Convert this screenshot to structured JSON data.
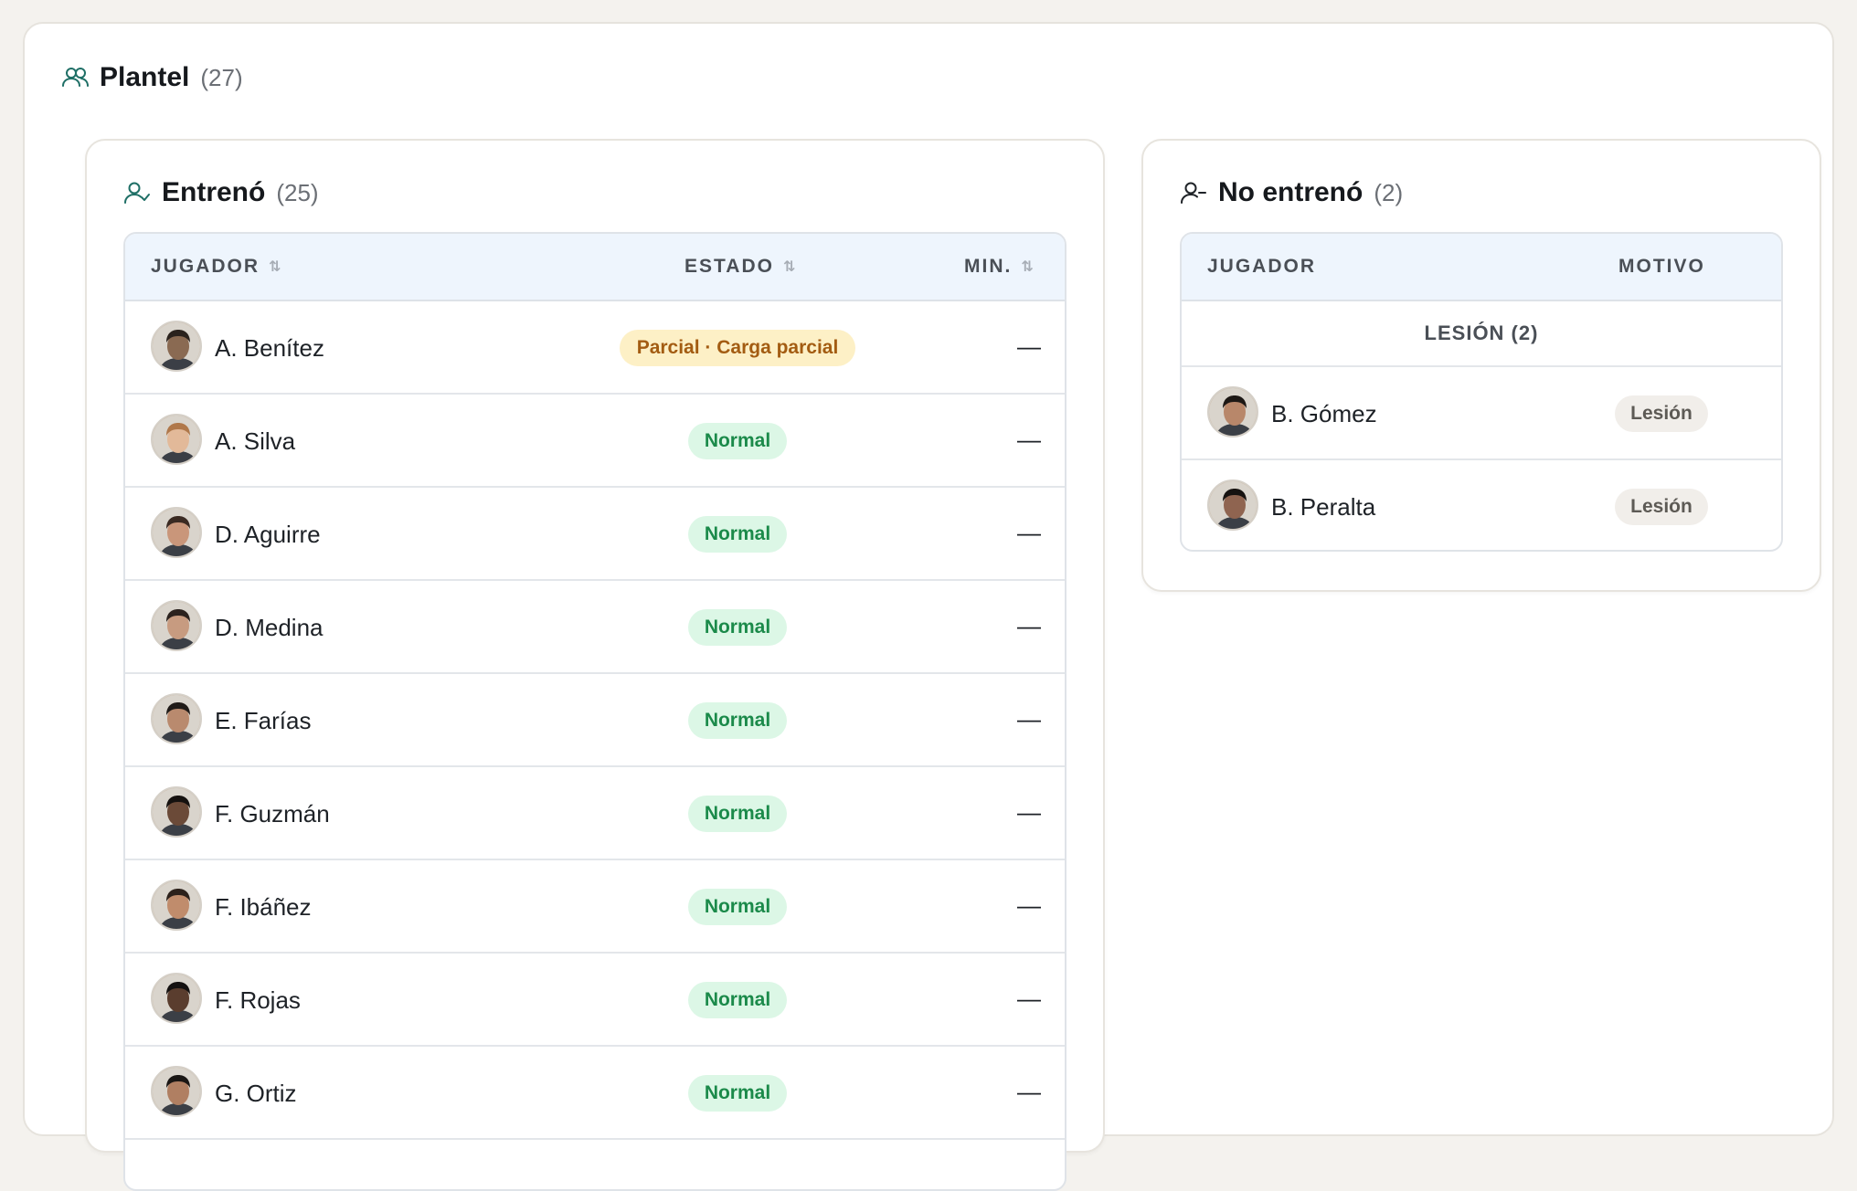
{
  "plantel": {
    "title": "Plantel",
    "count": "(27)"
  },
  "entreno": {
    "title": "Entrenó",
    "count": "(25)",
    "headers": {
      "player": "JUGADOR",
      "status": "ESTADO",
      "minutes": "MIN."
    },
    "sort_glyph": "⇅",
    "rows": [
      {
        "name": "A. Benítez",
        "status": "Parcial · Carga parcial",
        "status_kind": "partial",
        "minutes": "—",
        "skin": "#8a6a52",
        "hair": "#2a221d"
      },
      {
        "name": "A. Silva",
        "status": "Normal",
        "status_kind": "normal",
        "minutes": "—",
        "skin": "#e2b999",
        "hair": "#b0784a"
      },
      {
        "name": "D. Aguirre",
        "status": "Normal",
        "status_kind": "normal",
        "minutes": "—",
        "skin": "#c9967a",
        "hair": "#3a2a22"
      },
      {
        "name": "D. Medina",
        "status": "Normal",
        "status_kind": "normal",
        "minutes": "—",
        "skin": "#c79b80",
        "hair": "#2b221e"
      },
      {
        "name": "E. Farías",
        "status": "Normal",
        "status_kind": "normal",
        "minutes": "—",
        "skin": "#b98a6e",
        "hair": "#1f1a17"
      },
      {
        "name": "F. Guzmán",
        "status": "Normal",
        "status_kind": "normal",
        "minutes": "—",
        "skin": "#6b4a38",
        "hair": "#15110f"
      },
      {
        "name": "F. Ibáñez",
        "status": "Normal",
        "status_kind": "normal",
        "minutes": "—",
        "skin": "#c08c6c",
        "hair": "#2c211b"
      },
      {
        "name": "F. Rojas",
        "status": "Normal",
        "status_kind": "normal",
        "minutes": "—",
        "skin": "#5a3d2e",
        "hair": "#141110"
      },
      {
        "name": "G. Ortiz",
        "status": "Normal",
        "status_kind": "normal",
        "minutes": "—",
        "skin": "#b07f62",
        "hair": "#1a1614"
      }
    ]
  },
  "no_entreno": {
    "title": "No entrenó",
    "count": "(2)",
    "headers": {
      "player": "JUGADOR",
      "reason": "MOTIVO"
    },
    "group_label": "LESIÓN (2)",
    "rows": [
      {
        "name": "B. Gómez",
        "reason": "Lesión",
        "skin": "#b8876a",
        "hair": "#1d1815"
      },
      {
        "name": "B. Peralta",
        "reason": "Lesión",
        "skin": "#8f6450",
        "hair": "#161210"
      }
    ]
  },
  "colors": {
    "accent_icon": "#1f6f66",
    "header_bg": "#eef5fd",
    "badge_normal_bg": "#dcf7e6",
    "badge_normal_text": "#1b8a4a",
    "badge_partial_bg": "#fdf0c6",
    "badge_partial_text": "#a35c12"
  }
}
